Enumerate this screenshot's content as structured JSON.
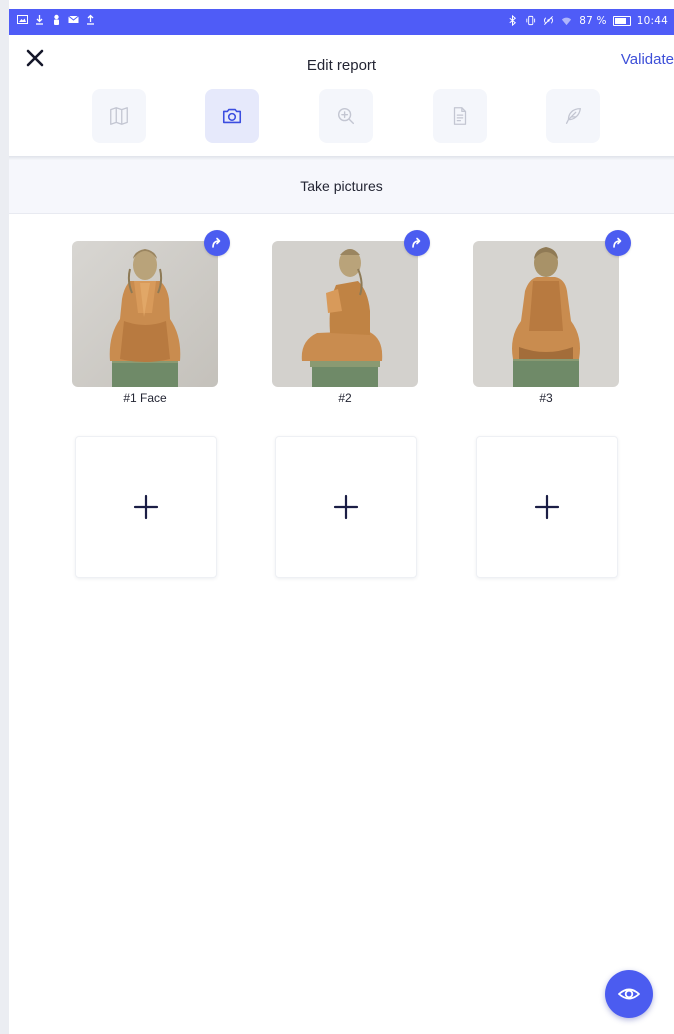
{
  "status_bar": {
    "battery_percent": "87 %",
    "time": "10:44",
    "background_color": "#4f5cf7",
    "left_icons": [
      "gallery-icon",
      "download-icon",
      "person-icon",
      "mail-icon",
      "upload-icon"
    ],
    "right_icons": [
      "bluetooth-icon",
      "vibrate-icon",
      "hotspot-icon",
      "wifi-icon",
      "battery-icon"
    ]
  },
  "header": {
    "title": "Edit report",
    "close_icon": "close-icon",
    "validate_label": "Validate",
    "accent_color": "#3d4fd8"
  },
  "tabs": [
    {
      "name": "book",
      "icon": "book-icon",
      "active": false
    },
    {
      "name": "camera",
      "icon": "camera-icon",
      "active": true
    },
    {
      "name": "zoom",
      "icon": "zoom-in-icon",
      "active": false
    },
    {
      "name": "document",
      "icon": "document-icon",
      "active": false
    },
    {
      "name": "signature",
      "icon": "feather-icon",
      "active": false
    }
  ],
  "section": {
    "title": "Take pictures"
  },
  "photos": [
    {
      "label": "#1 Face",
      "rotate_icon": "rotate-icon"
    },
    {
      "label": "#2",
      "rotate_icon": "rotate-icon"
    },
    {
      "label": "#3",
      "rotate_icon": "rotate-icon"
    }
  ],
  "add_slots": [
    {
      "icon": "plus-icon"
    },
    {
      "icon": "plus-icon"
    },
    {
      "icon": "plus-icon"
    }
  ],
  "fab": {
    "icon": "eye-icon",
    "color": "#4b5cf0"
  }
}
